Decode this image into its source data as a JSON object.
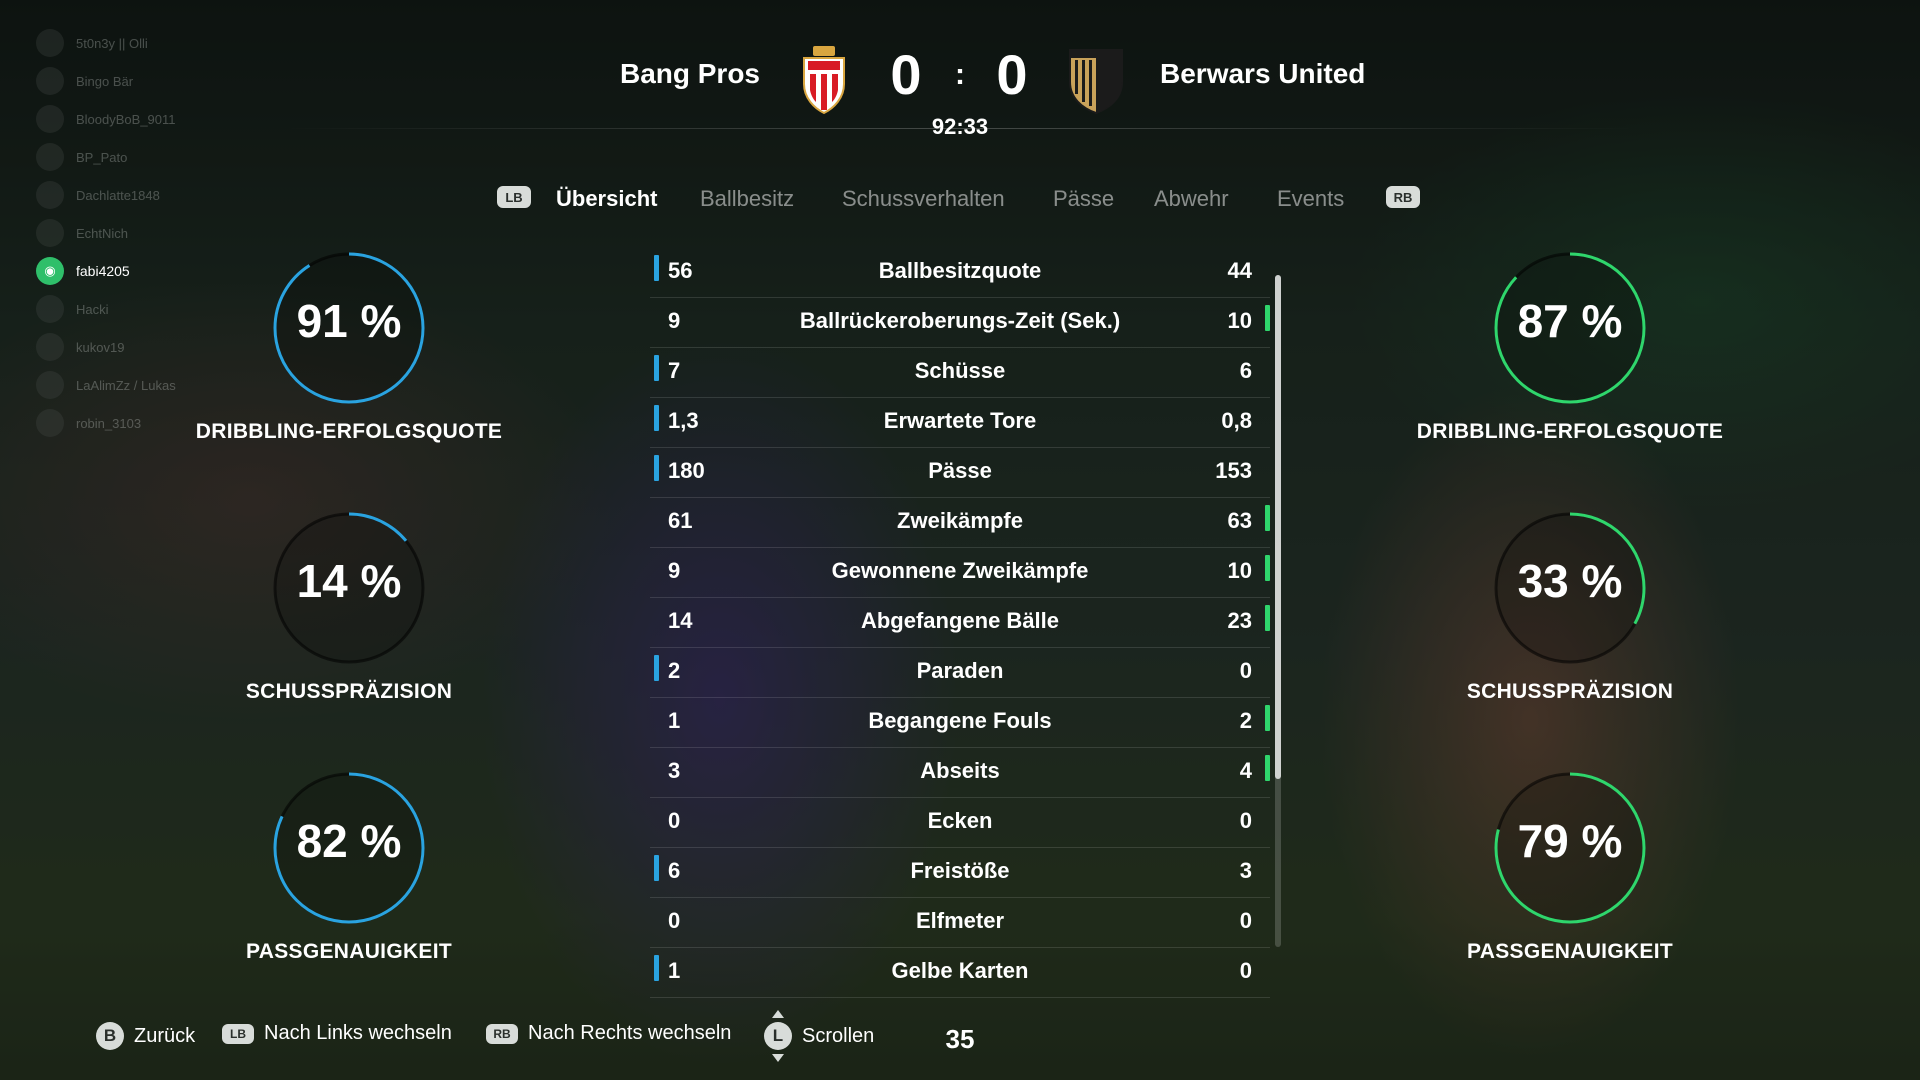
{
  "friends": [
    {
      "name": "5t0n3y || Olli",
      "online": false
    },
    {
      "name": "Bingo Bär",
      "online": false
    },
    {
      "name": "BloodyBoB_9011",
      "online": false
    },
    {
      "name": "BP_Pato",
      "online": false
    },
    {
      "name": "Dachlatte1848",
      "online": false
    },
    {
      "name": "EchtNich",
      "online": false
    },
    {
      "name": "fabi4205",
      "online": true
    },
    {
      "name": "Hacki",
      "online": false
    },
    {
      "name": "kukov19",
      "online": false
    },
    {
      "name": "LaAlimZz / Lukas",
      "online": false
    },
    {
      "name": "robin_3103",
      "online": false
    }
  ],
  "match": {
    "home_team": "Bang Pros",
    "away_team": "Berwars United",
    "home_score": "0",
    "away_score": "0",
    "separator": ":",
    "clock": "92:33"
  },
  "colors": {
    "home_accent": "#2aa3e0",
    "away_accent": "#2fd66c"
  },
  "tabs": {
    "left_bumper": "LB",
    "right_bumper": "RB",
    "items": [
      "Übersicht",
      "Ballbesitz",
      "Schussverhalten",
      "Pässe",
      "Abwehr",
      "Events"
    ],
    "active_index": 0
  },
  "home_gauges": [
    {
      "value": "91 %",
      "fraction": 0.91,
      "label": "DRIBBLING-ERFOLGSQUOTE"
    },
    {
      "value": "14 %",
      "fraction": 0.14,
      "label": "SCHUSSPRÄZISION"
    },
    {
      "value": "82 %",
      "fraction": 0.82,
      "label": "PASSGENAUIGKEIT"
    }
  ],
  "away_gauges": [
    {
      "value": "87 %",
      "fraction": 0.87,
      "label": "DRIBBLING-ERFOLGSQUOTE"
    },
    {
      "value": "33 %",
      "fraction": 0.33,
      "label": "SCHUSSPRÄZISION"
    },
    {
      "value": "79 %",
      "fraction": 0.79,
      "label": "PASSGENAUIGKEIT"
    }
  ],
  "stats": [
    {
      "name": "Ballbesitzquote",
      "home": "56",
      "away": "44",
      "leader": "home"
    },
    {
      "name": "Ballrückeroberungs-Zeit (Sek.)",
      "home": "9",
      "away": "10",
      "leader": "away"
    },
    {
      "name": "Schüsse",
      "home": "7",
      "away": "6",
      "leader": "home"
    },
    {
      "name": "Erwartete Tore",
      "home": "1,3",
      "away": "0,8",
      "leader": "home"
    },
    {
      "name": "Pässe",
      "home": "180",
      "away": "153",
      "leader": "home"
    },
    {
      "name": "Zweikämpfe",
      "home": "61",
      "away": "63",
      "leader": "away"
    },
    {
      "name": "Gewonnene Zweikämpfe",
      "home": "9",
      "away": "10",
      "leader": "away"
    },
    {
      "name": "Abgefangene Bälle",
      "home": "14",
      "away": "23",
      "leader": "away"
    },
    {
      "name": "Paraden",
      "home": "2",
      "away": "0",
      "leader": "home"
    },
    {
      "name": "Begangene Fouls",
      "home": "1",
      "away": "2",
      "leader": "away"
    },
    {
      "name": "Abseits",
      "home": "3",
      "away": "4",
      "leader": "away"
    },
    {
      "name": "Ecken",
      "home": "0",
      "away": "0",
      "leader": "none"
    },
    {
      "name": "Freistöße",
      "home": "6",
      "away": "3",
      "leader": "home"
    },
    {
      "name": "Elfmeter",
      "home": "0",
      "away": "0",
      "leader": "none"
    },
    {
      "name": "Gelbe Karten",
      "home": "1",
      "away": "0",
      "leader": "home"
    }
  ],
  "footer": {
    "back_key": "B",
    "back_label": "Zurück",
    "left_key": "LB",
    "left_label": "Nach Links wechseln",
    "right_key": "RB",
    "right_label": "Nach Rechts wechseln",
    "scroll_key": "L",
    "scroll_label": "Scrollen",
    "number": "35"
  }
}
